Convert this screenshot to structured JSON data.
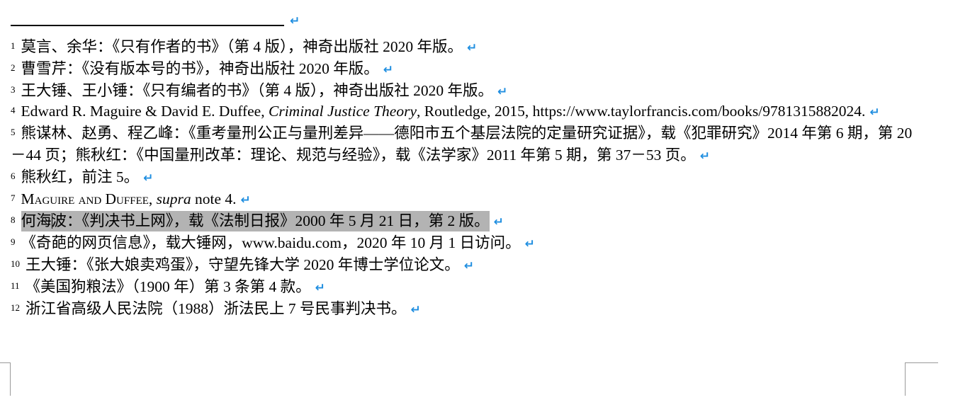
{
  "footnotes": [
    {
      "num": "1",
      "text": "莫言、余华：《只有作者的书》（第 4 版），神奇出版社 2020 年版。"
    },
    {
      "num": "2",
      "text": "曹雪芹：《没有版本号的书》，神奇出版社 2020 年版。"
    },
    {
      "num": "3",
      "text": "王大锤、王小锤：《只有编者的书》（第 4 版），神奇出版社 2020 年版。"
    },
    {
      "num": "4",
      "text_before": "Edward R. Maguire & David E. Duffee, ",
      "italic": "Criminal Justice Theory",
      "text_after": ", Routledge, 2015, https://www.taylorfrancis.com/books/9781315882024."
    },
    {
      "num": "5",
      "text": "熊谋林、赵勇、程乙峰：《重考量刑公正与量刑差异——德阳市五个基层法院的定量研究证据》，载《犯罪研究》2014 年第 6 期，第 20－44 页；熊秋红：《中国量刑改革：理论、规范与经验》，载《法学家》2011 年第 5 期，第 37－53 页。"
    },
    {
      "num": "6",
      "text": "熊秋红，前注 5。"
    },
    {
      "num": "7",
      "sc_text": "Maguire and Duffee",
      "sep": ", ",
      "italic": "supra",
      "text_after": " note 4."
    },
    {
      "num": "8",
      "text_a": "何海",
      "text_b": "波：《判决书上网》，载《法制日报》2000 年 5 月 21 日，第 2 版。"
    },
    {
      "num": "9",
      "text": "《奇葩的网页信息》，载大锤网，www.baidu.com，2020 年 10 月 1 日访问。"
    },
    {
      "num": "10",
      "text": "王大锤：《张大娘卖鸡蛋》，守望先锋大学 2020 年博士学位论文。"
    },
    {
      "num": "11",
      "text": "《美国狗粮法》（1900 年）第 3 条第 4 款。"
    },
    {
      "num": "12",
      "text": "浙江省高级人民法院（1988）浙法民上  7  号民事判决书。"
    }
  ],
  "marks": {
    "paragraph": "↵"
  },
  "colors": {
    "paragraph_mark": "#1f8ee0",
    "highlight": "#b3b3b3"
  }
}
